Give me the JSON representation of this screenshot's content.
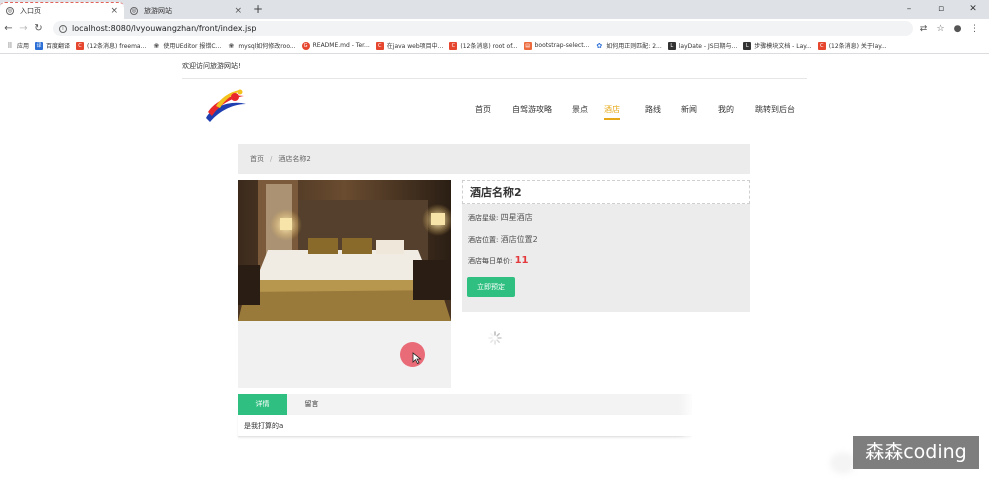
{
  "browser": {
    "tabs": [
      {
        "title": "入口页",
        "close": "×"
      },
      {
        "title": "旅游网站",
        "close": "×"
      }
    ],
    "new_tab": "+",
    "window_buttons": [
      "–",
      "▫",
      "✕"
    ],
    "url": "localhost:8080/lvyouwangzhan/front/index.jsp",
    "bookmarks": [
      {
        "label": "应用",
        "icon": "apps-icon"
      },
      {
        "label": "百度翻译",
        "icon": "baidu-translate-icon"
      },
      {
        "label": "(12条消息) freema...",
        "icon": "csdn-icon"
      },
      {
        "label": "使用UEditor 报错C...",
        "icon": "paw-icon"
      },
      {
        "label": "mysql如何修改roo...",
        "icon": "paw-icon"
      },
      {
        "label": "README.md - Ter...",
        "icon": "github-icon"
      },
      {
        "label": "在java web项目中...",
        "icon": "csdn-icon"
      },
      {
        "label": "(12条消息) root of...",
        "icon": "csdn-icon"
      },
      {
        "label": "bootstrap-select...",
        "icon": "doc-icon"
      },
      {
        "label": "如何用正则匹配: 2...",
        "icon": "zhihu-icon"
      },
      {
        "label": "layDate - JS日期与...",
        "icon": "layui-icon"
      },
      {
        "label": "步骤模块文档 - Lay...",
        "icon": "layui-icon"
      },
      {
        "label": "(12条消息) 关于lay...",
        "icon": "csdn-icon"
      }
    ]
  },
  "header": {
    "welcome": "欢迎访问旅游网站!",
    "nav": [
      "首页",
      "自驾游攻略",
      "景点",
      "酒店",
      "路线",
      "新闻",
      "我的",
      "跳转到后台"
    ],
    "active_nav": "酒店"
  },
  "breadcrumb": [
    "首页",
    "/",
    "酒店名称2"
  ],
  "hotel": {
    "name": "酒店名称2",
    "star_label": "酒店星级:",
    "star_value": "四星酒店",
    "location_label": "酒店位置:",
    "location_value": "酒店位置2",
    "price_label": "酒店每日单价:",
    "price_value": "11",
    "book_button": "立即预定"
  },
  "detail_tabs": [
    "详情",
    "留言"
  ],
  "detail_content": "是我打算的a",
  "watermark": "森森coding",
  "colors": {
    "accent_green": "#2fc081",
    "nav_active": "#e6a817",
    "price_red": "#e4393c"
  }
}
